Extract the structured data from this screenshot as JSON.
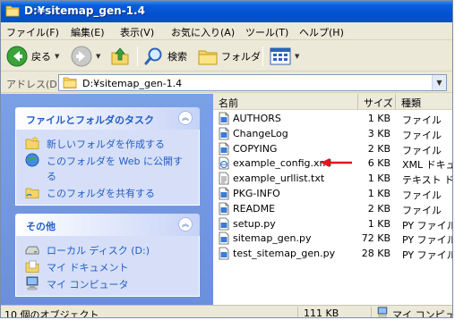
{
  "window": {
    "title": "D:¥sitemap_gen-1.4"
  },
  "menu": [
    "ファイル(F)",
    "編集(E)",
    "表示(V)",
    "お気に入り(A)",
    "ツール(T)",
    "ヘルプ(H)"
  ],
  "toolbar": {
    "back": "戻る",
    "search": "検索",
    "folders": "フォルダ"
  },
  "address": {
    "label": "アドレス(D)",
    "value": "D:¥sitemap_gen-1.4"
  },
  "tasks": {
    "title": "ファイルとフォルダのタスク",
    "items": [
      {
        "icon": "new-folder-icon",
        "label": "新しいフォルダを作成する"
      },
      {
        "icon": "web-publish-icon",
        "label": "このフォルダを Web に公開す"
      },
      {
        "label": "る"
      },
      {
        "icon": "share-folder-icon",
        "label": "このフォルダを共有する"
      }
    ]
  },
  "other": {
    "title": "その他",
    "items": [
      {
        "icon": "local-disk-icon",
        "label": "ローカル ディスク (D:)"
      },
      {
        "icon": "my-documents-icon",
        "label": "マイ ドキュメント"
      },
      {
        "icon": "my-computer-icon",
        "label": "マイ コンピュータ"
      }
    ]
  },
  "filelist": {
    "columns": {
      "name": "名前",
      "size": "サイズ",
      "type": "種類"
    },
    "files": [
      {
        "name": "AUTHORS",
        "size": "1 KB",
        "type": "ファイル",
        "icon": "file-icon"
      },
      {
        "name": "ChangeLog",
        "size": "3 KB",
        "type": "ファイル",
        "icon": "file-icon"
      },
      {
        "name": "COPYING",
        "size": "2 KB",
        "type": "ファイル",
        "icon": "file-icon"
      },
      {
        "name": "example_config.xml",
        "size": "6 KB",
        "type": "XML ドキュ",
        "icon": "xml-file-icon"
      },
      {
        "name": "example_urllist.txt",
        "size": "1 KB",
        "type": "テキスト ド",
        "icon": "text-file-icon"
      },
      {
        "name": "PKG-INFO",
        "size": "1 KB",
        "type": "ファイル",
        "icon": "file-icon"
      },
      {
        "name": "README",
        "size": "2 KB",
        "type": "ファイル",
        "icon": "file-icon"
      },
      {
        "name": "setup.py",
        "size": "1 KB",
        "type": "PY ファイル",
        "icon": "py-file-icon"
      },
      {
        "name": "sitemap_gen.py",
        "size": "72 KB",
        "type": "PY ファイル",
        "icon": "py-file-icon"
      },
      {
        "name": "test_sitemap_gen.py",
        "size": "28 KB",
        "type": "PY ファイル",
        "icon": "py-file-icon"
      }
    ]
  },
  "status": {
    "count": "10 個のオブジェクト",
    "size": "111 KB",
    "location": "マイ コンピュ"
  },
  "colors": {
    "titlebar": "#0251d0",
    "taskpane": "#7aa1e6",
    "link": "#215dc6",
    "arrow": "#e8141c"
  }
}
